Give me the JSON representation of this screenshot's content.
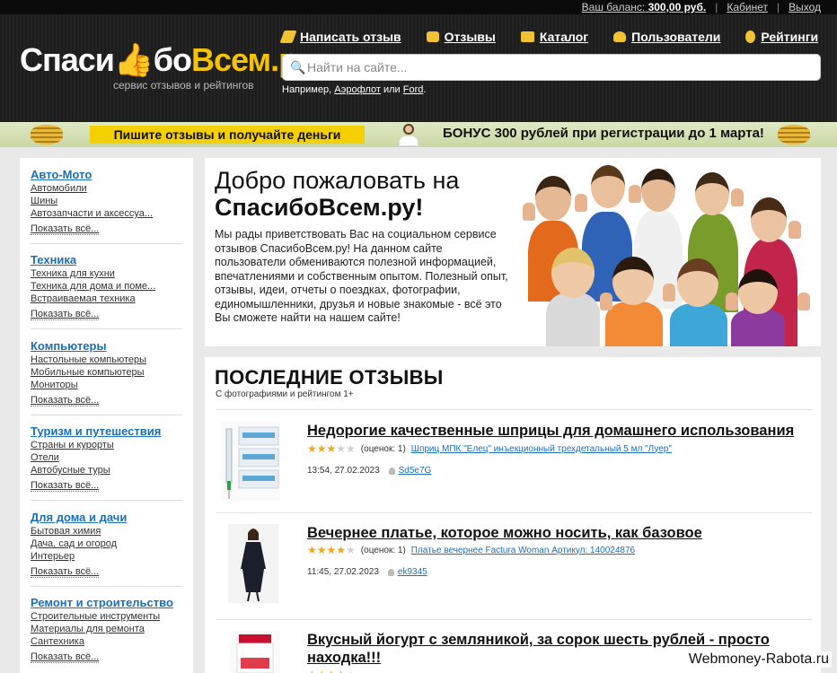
{
  "topbar": {
    "balance_label": "Ваш баланс:",
    "balance_value": "300,00 руб.",
    "cabinet": "Кабинет",
    "logout": "Выход"
  },
  "header": {
    "logo_text_1": "Спаси",
    "logo_text_2": "бо",
    "logo_text_3": "Всем.ру",
    "logo_sub": "сервис отзывов и рейтингов",
    "nav": [
      {
        "label": "Написать отзыв",
        "icon": "pencil-icon"
      },
      {
        "label": "Отзывы",
        "icon": "speech-icon"
      },
      {
        "label": "Каталог",
        "icon": "catalog-icon"
      },
      {
        "label": "Пользователи",
        "icon": "users-icon"
      },
      {
        "label": "Рейтинги",
        "icon": "bulb-icon"
      }
    ],
    "search_placeholder": "Найти на сайте...",
    "example_prefix": "Например,",
    "example_1": "Аэрофлот",
    "example_or": "или",
    "example_2": "Ford",
    "example_suffix": "."
  },
  "promo": {
    "left": "Пишите отзывы и получайте деньги",
    "right": "БОНУС 300 рублей при регистрации до 1 марта!"
  },
  "sidebar": {
    "categories": [
      {
        "title": "Авто-Мото",
        "items": [
          "Автомобили",
          "Шины",
          "Автозапчасти и аксессуа..."
        ],
        "more": "Показать всё..."
      },
      {
        "title": "Техника",
        "items": [
          "Техника для кухни",
          "Техника для дома и поме...",
          "Встраиваемая техника"
        ],
        "more": "Показать всё..."
      },
      {
        "title": "Компьютеры",
        "items": [
          "Настольные компьютеры",
          "Мобильные компьютеры",
          "Мониторы"
        ],
        "more": "Показать всё..."
      },
      {
        "title": "Туризм и путешествия",
        "items": [
          "Страны и курорты",
          "Отели",
          "Автобусные туры"
        ],
        "more": "Показать всё..."
      },
      {
        "title": "Для дома и дачи",
        "items": [
          "Бытовая химия",
          "Дача, сад и огород",
          "Интерьер"
        ],
        "more": "Показать всё..."
      },
      {
        "title": "Ремонт и строительство",
        "items": [
          "Строительные инструменты",
          "Материалы для ремонта",
          "Сантехника"
        ],
        "more": "Показать всё..."
      }
    ]
  },
  "welcome": {
    "title_line1": "Добро пожаловать на",
    "title_line2": "СпасибоВсем.ру!",
    "text": "Мы рады приветствовать Вас на социальном сервисе отзывов СпасибоВсем.ру! На данном сайте пользователи обмениваются полезной информацией, впечатлениями и собственным опытом. Полезный опыт, отзывы, идеи, отчеты о поездках, фотографии, единомышленники, друзья и новые знакомые - всё это Вы сможете найти на нашем сайте!"
  },
  "reviews": {
    "title": "ПОСЛЕДНИЕ ОТЗЫВЫ",
    "subtitle": "С фотографиями и рейтингом 1+",
    "items": [
      {
        "title": "Недорогие качественные шприцы для домашнего использования",
        "rating": 3,
        "score": "(оценок: 1)",
        "product": "Шприц МПК \"Елец\" инъекционный трехдетальный 5 мл \"Луер\"",
        "time": "13:54, 27.02.2023",
        "user": "Sd5e7G"
      },
      {
        "title": "Вечернее платье, которое можно носить, как базовое",
        "rating": 4,
        "score": "(оценок: 1)",
        "product": "Платье вечернее Factura Woman Артикул: 140024876",
        "time": "11:45, 27.02.2023",
        "user": "ek9345"
      },
      {
        "title": "Вкусный йогурт с земляникой, за сорок шесть рублей - просто находка!!!",
        "rating": 4,
        "score": "",
        "product": "",
        "time": "",
        "user": ""
      }
    ]
  },
  "watermark": "Webmoney-Rabota.ru"
}
